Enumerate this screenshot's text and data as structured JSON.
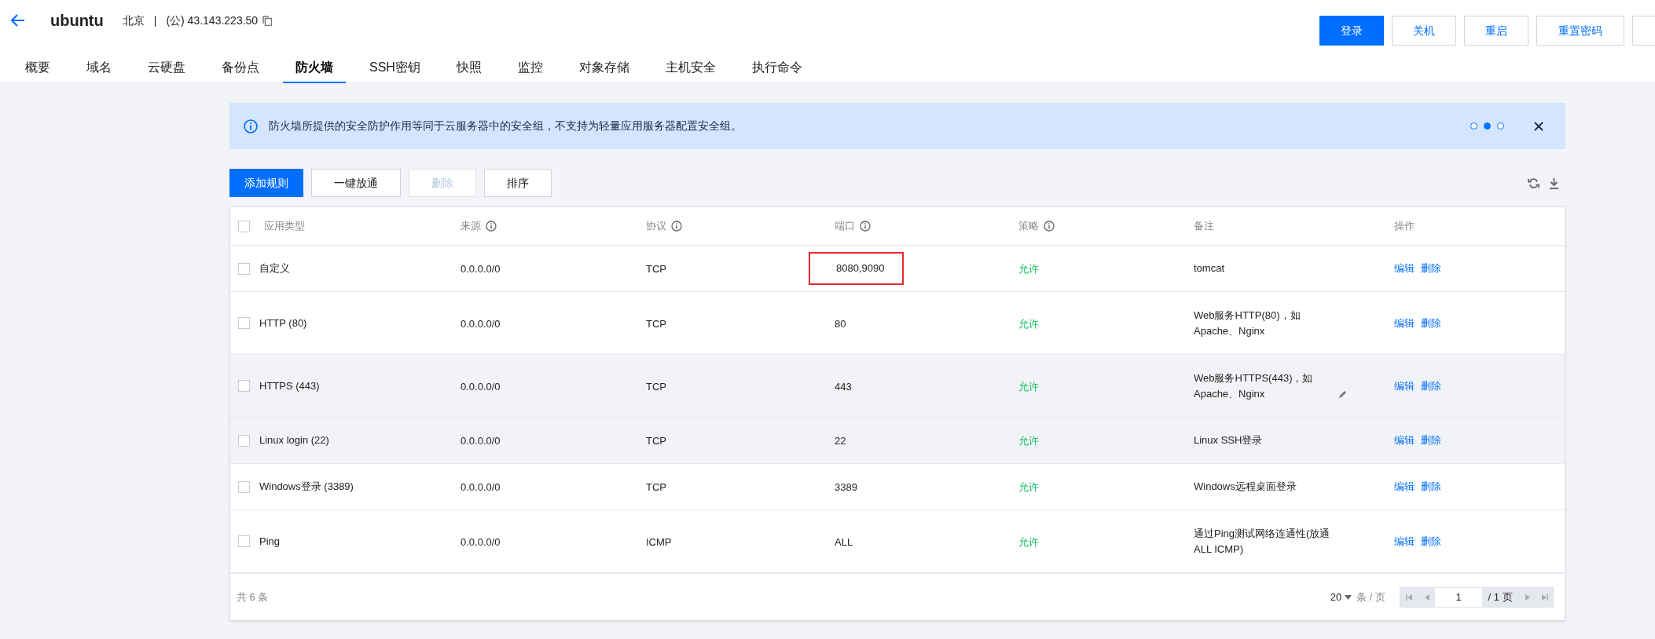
{
  "header": {
    "title": "ubuntu",
    "region": "北京",
    "separator": "|",
    "ip": "(公) 43.143.223.50",
    "buttons": [
      {
        "label": "登录",
        "primary": true
      },
      {
        "label": "关机",
        "primary": false
      },
      {
        "label": "重启",
        "primary": false
      },
      {
        "label": "重置密码",
        "primary": false
      }
    ]
  },
  "tabs": [
    {
      "label": "概要",
      "selected": false
    },
    {
      "label": "域名",
      "selected": false
    },
    {
      "label": "云硬盘",
      "selected": false
    },
    {
      "label": "备份点",
      "selected": false
    },
    {
      "label": "防火墙",
      "selected": true
    },
    {
      "label": "SSH密钥",
      "selected": false
    },
    {
      "label": "快照",
      "selected": false
    },
    {
      "label": "监控",
      "selected": false
    },
    {
      "label": "对象存储",
      "selected": false
    },
    {
      "label": "主机安全",
      "selected": false
    },
    {
      "label": "执行命令",
      "selected": false
    }
  ],
  "notice": {
    "text": "防火墙所提供的安全防护作用等同于云服务器中的安全组，不支持为轻量应用服务器配置安全组。",
    "pages": [
      {
        "selected": false
      },
      {
        "selected": true
      },
      {
        "selected": false
      }
    ]
  },
  "toolbar": [
    {
      "label": "添加规则",
      "primary": true,
      "disabled": false
    },
    {
      "label": "一键放通",
      "primary": false,
      "disabled": false
    },
    {
      "label": "删除",
      "primary": false,
      "disabled": true
    },
    {
      "label": "排序",
      "primary": false,
      "disabled": false
    }
  ],
  "table": {
    "all_checked": false,
    "columns": [
      {
        "label": "应用类型",
        "info": false
      },
      {
        "label": "来源",
        "info": true
      },
      {
        "label": "协议",
        "info": true
      },
      {
        "label": "端口",
        "info": true
      },
      {
        "label": "策略",
        "info": true
      },
      {
        "label": "备注",
        "info": false
      },
      {
        "label": "操作",
        "info": false
      }
    ],
    "rows": [
      {
        "checked": false,
        "type": "自定义",
        "source": "0.0.0.0/0",
        "protocol": "TCP",
        "port": "8080,9090",
        "port_marked": true,
        "policy": "允许",
        "note": "tomcat",
        "note_editable": false,
        "shaded": false,
        "actions": [
          "编辑",
          "删除"
        ]
      },
      {
        "checked": false,
        "type": "HTTP (80)",
        "source": "0.0.0.0/0",
        "protocol": "TCP",
        "port": "80",
        "port_marked": false,
        "policy": "允许",
        "note": "Web服务HTTP(80)，如Apache、Nginx",
        "note_editable": false,
        "shaded": false,
        "actions": [
          "编辑",
          "删除"
        ]
      },
      {
        "checked": false,
        "type": "HTTPS (443)",
        "source": "0.0.0.0/0",
        "protocol": "TCP",
        "port": "443",
        "port_marked": false,
        "policy": "允许",
        "note": "Web服务HTTPS(443)，如Apache、Nginx",
        "note_editable": true,
        "shaded": true,
        "actions": [
          "编辑",
          "删除"
        ]
      },
      {
        "checked": false,
        "type": "Linux login (22)",
        "source": "0.0.0.0/0",
        "protocol": "TCP",
        "port": "22",
        "port_marked": false,
        "policy": "允许",
        "note": "Linux SSH登录",
        "note_editable": false,
        "shaded": true,
        "actions": [
          "编辑",
          "删除"
        ]
      },
      {
        "checked": false,
        "type": "Windows登录 (3389)",
        "source": "0.0.0.0/0",
        "protocol": "TCP",
        "port": "3389",
        "port_marked": false,
        "policy": "允许",
        "note": "Windows远程桌面登录",
        "note_editable": false,
        "shaded": false,
        "actions": [
          "编辑",
          "删除"
        ]
      },
      {
        "checked": false,
        "type": "Ping",
        "source": "0.0.0.0/0",
        "protocol": "ICMP",
        "port": "ALL",
        "port_marked": false,
        "policy": "允许",
        "note": "通过Ping测试网络连通性(放通ALL ICMP)",
        "note_editable": false,
        "shaded": false,
        "actions": [
          "编辑",
          "删除"
        ]
      }
    ]
  },
  "footer": {
    "total": "共 6 条",
    "page_size": "20",
    "per_page": "条 / 页",
    "page": "1",
    "page_total": "/ 1 页"
  }
}
